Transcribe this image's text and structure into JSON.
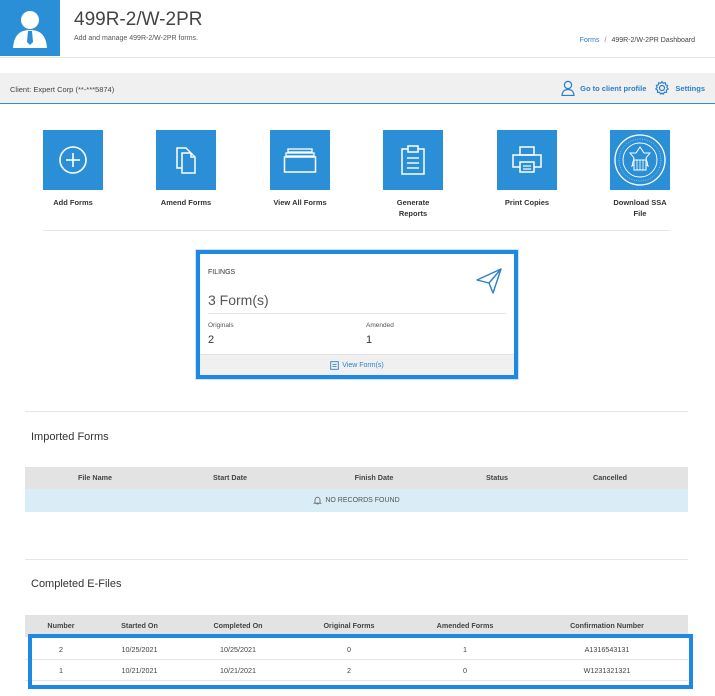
{
  "header": {
    "title": "499R-2/W-2PR",
    "subtitle": "Add and manage 499R-2/W-2PR forms.",
    "breadcrumb": {
      "link": "Forms",
      "separator": "/",
      "current": "499R-2/W-2PR Dashboard"
    }
  },
  "client_bar": {
    "client_label": "Client: Expert Corp (**-***5874)",
    "go_to_profile": "Go to client profile",
    "settings": "Settings"
  },
  "tiles": [
    {
      "label": "Add Forms",
      "icon": "add-circle-icon"
    },
    {
      "label": "Amend Forms",
      "icon": "documents-icon"
    },
    {
      "label": "View All Forms",
      "icon": "folders-icon"
    },
    {
      "label": "Generate Reports",
      "icon": "clipboard-icon"
    },
    {
      "label": "Print Copies",
      "icon": "printer-icon"
    },
    {
      "label": "Download SSA File",
      "icon": "ssa-seal-icon"
    }
  ],
  "filings": {
    "label": "FILINGS",
    "count": "3 Form(s)",
    "originals_label": "Originals",
    "originals_value": "2",
    "amended_label": "Amended",
    "amended_value": "1",
    "view_link": "View Form(s)"
  },
  "imported_forms": {
    "title": "Imported Forms",
    "columns": [
      "File Name",
      "Start Date",
      "Finish Date",
      "Status",
      "Cancelled"
    ],
    "empty_message": "NO RECORDS FOUND"
  },
  "completed_efiles": {
    "title": "Completed E-Files",
    "columns": [
      "Number",
      "Started On",
      "Completed On",
      "Original Forms",
      "Amended Forms",
      "Confirmation Number"
    ],
    "rows": [
      [
        "2",
        "10/25/2021",
        "10/25/2021",
        "0",
        "1",
        "A1316543131"
      ],
      [
        "1",
        "10/21/2021",
        "10/21/2021",
        "2",
        "0",
        "W1231321321"
      ]
    ]
  },
  "colors": {
    "accent": "#2a8fd6",
    "link": "#2a7fc9",
    "highlight": "#1e88e5"
  }
}
